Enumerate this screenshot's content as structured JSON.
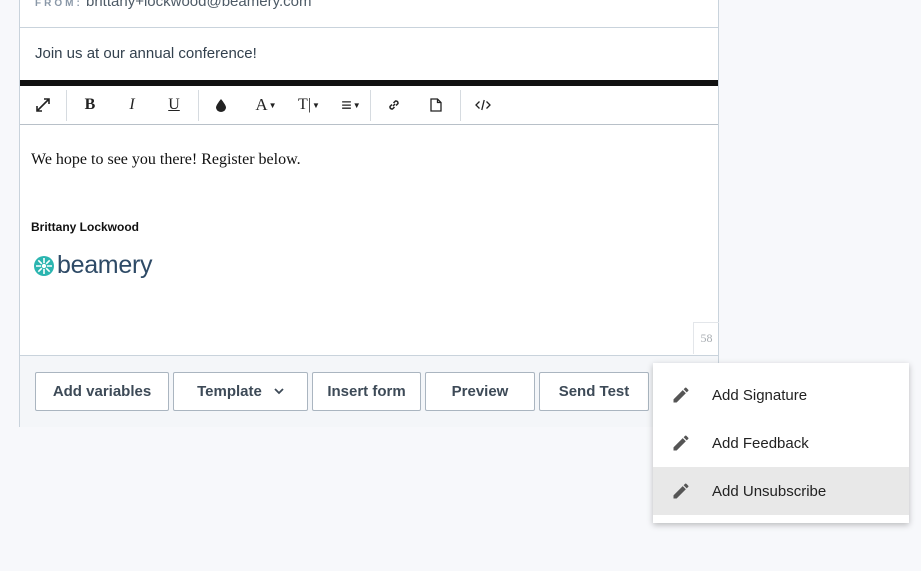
{
  "header": {
    "from_label": "FROM:",
    "from_value": "brittany+lockwood@beamery.com",
    "subject": "Join us at our annual conference!"
  },
  "toolbar": {
    "items": [
      {
        "name": "fullscreen",
        "label": "⤢"
      },
      {
        "name": "bold",
        "label": "B"
      },
      {
        "name": "italic",
        "label": "I"
      },
      {
        "name": "underline",
        "label": "U"
      },
      {
        "name": "color",
        "label": "●"
      },
      {
        "name": "font",
        "label": "A"
      },
      {
        "name": "text-size",
        "label": "T|"
      },
      {
        "name": "align",
        "label": "≡"
      },
      {
        "name": "link",
        "label": "🔗"
      },
      {
        "name": "file",
        "label": "🗋"
      },
      {
        "name": "code",
        "label": "</>"
      }
    ]
  },
  "editor": {
    "body_text": "We hope to see you there! Register below.",
    "signature_name": "Brittany Lockwood",
    "logo_text": "beamery",
    "char_count": "58"
  },
  "footer": {
    "buttons": {
      "add_variables": "Add variables",
      "template": "Template",
      "insert_form": "Insert form",
      "preview": "Preview",
      "send_test": "Send Test"
    }
  },
  "menu": {
    "items": [
      {
        "label": "Add Signature",
        "icon": "pencil-icon",
        "active": false
      },
      {
        "label": "Add Feedback",
        "icon": "pencil-icon",
        "active": false
      },
      {
        "label": "Add Unsubscribe",
        "icon": "pencil-icon",
        "active": true
      }
    ]
  },
  "colors": {
    "accent_teal": "#2bb5b0",
    "logo_navy": "#2e4a66",
    "border": "#c9d3dc"
  }
}
